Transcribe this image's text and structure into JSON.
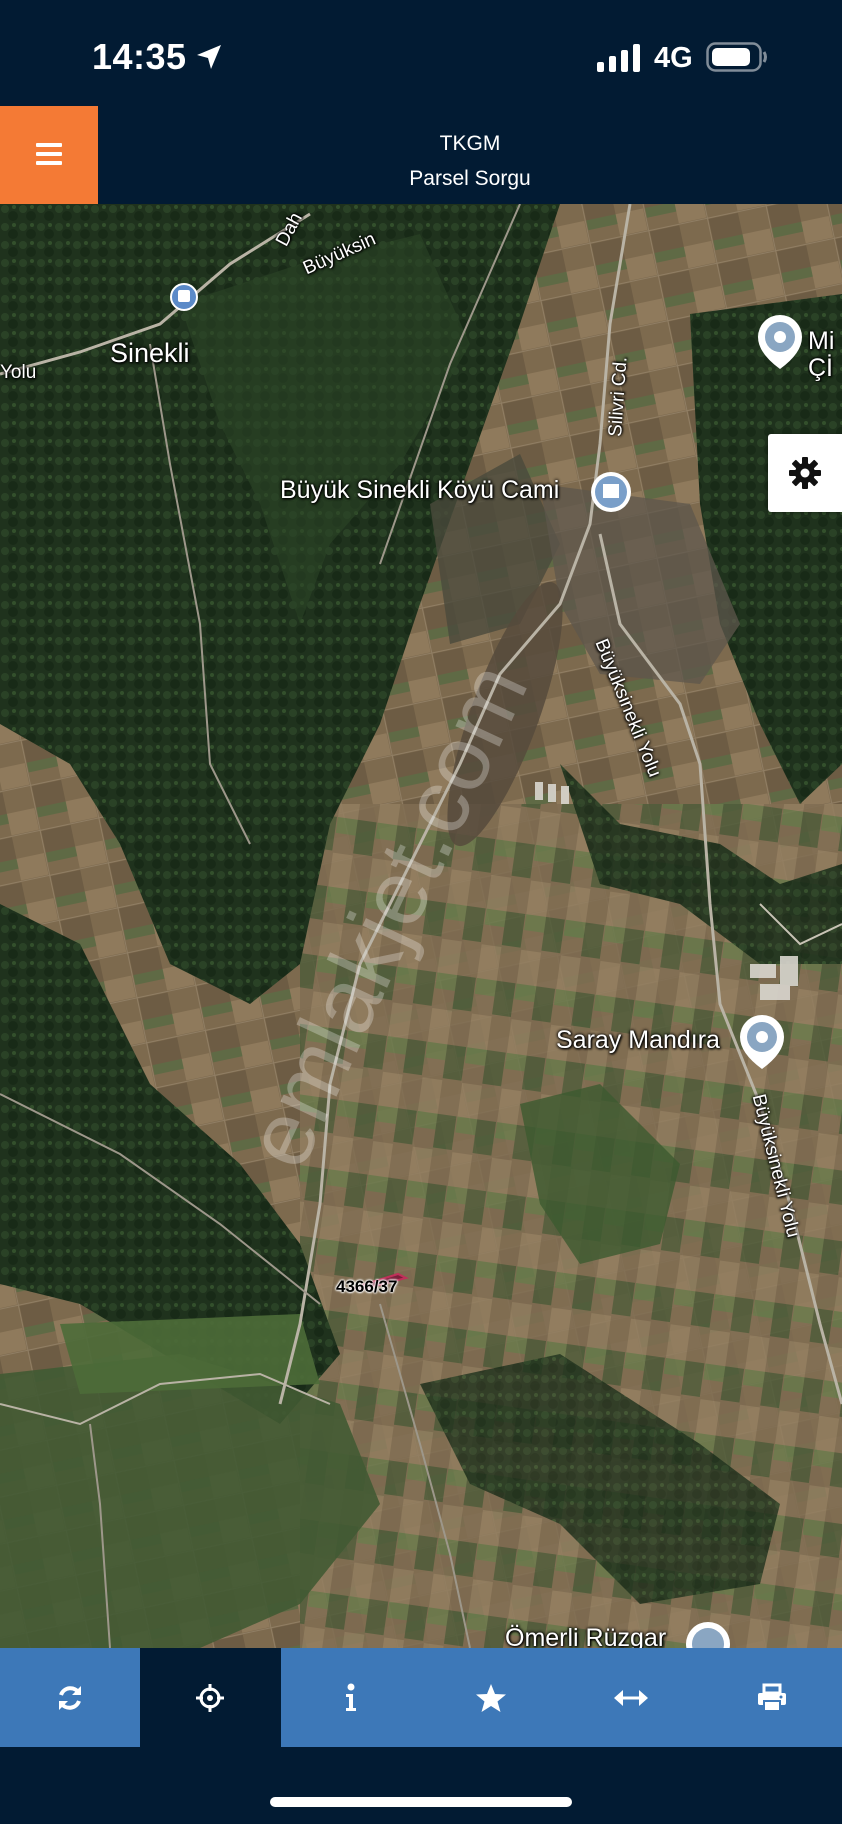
{
  "status_bar": {
    "time": "14:35",
    "network": "4G",
    "icons": [
      "location-arrow-icon",
      "signal-icon",
      "battery-icon"
    ]
  },
  "header": {
    "title": "TKGM",
    "subtitle": "Parsel Sorgu",
    "menu_icon": "hamburger-icon",
    "menu_color": "#f47a35",
    "bar_color": "#021b33"
  },
  "map": {
    "labels": {
      "sinekli": "Sinekli",
      "yolu_left": "Yolu",
      "buyuk_sinekli_koyu_cami": "Büyük Sinekli Köyü Cami",
      "silivri_cd": "Silivri Cd.",
      "buyuksinekli_yolu_1": "Büyüksinekli Yolu",
      "buyuksinekli_yolu_2": "Büyüksinekli Yolu",
      "saray_mandira": "Saray Mandıra",
      "omerli_ruzgar": "Ömerli Rüzgar",
      "mi_cif": "Mi Çİ",
      "dah": "Dah",
      "buyuksin_top": "Büyüksin"
    },
    "parcel": "4366/37",
    "watermark": "emlakjet.com",
    "settings_icon": "gear-icon"
  },
  "toolbar": {
    "buttons": [
      {
        "name": "refresh",
        "icon": "refresh-icon",
        "active": false
      },
      {
        "name": "locate",
        "icon": "crosshair-icon",
        "active": true
      },
      {
        "name": "info",
        "icon": "info-icon",
        "active": false
      },
      {
        "name": "favorite",
        "icon": "star-icon",
        "active": false
      },
      {
        "name": "measure",
        "icon": "horizontal-arrows-icon",
        "active": false
      },
      {
        "name": "print",
        "icon": "print-icon",
        "active": false
      }
    ],
    "bar_color": "#3d78b8",
    "active_color": "#021b33"
  }
}
